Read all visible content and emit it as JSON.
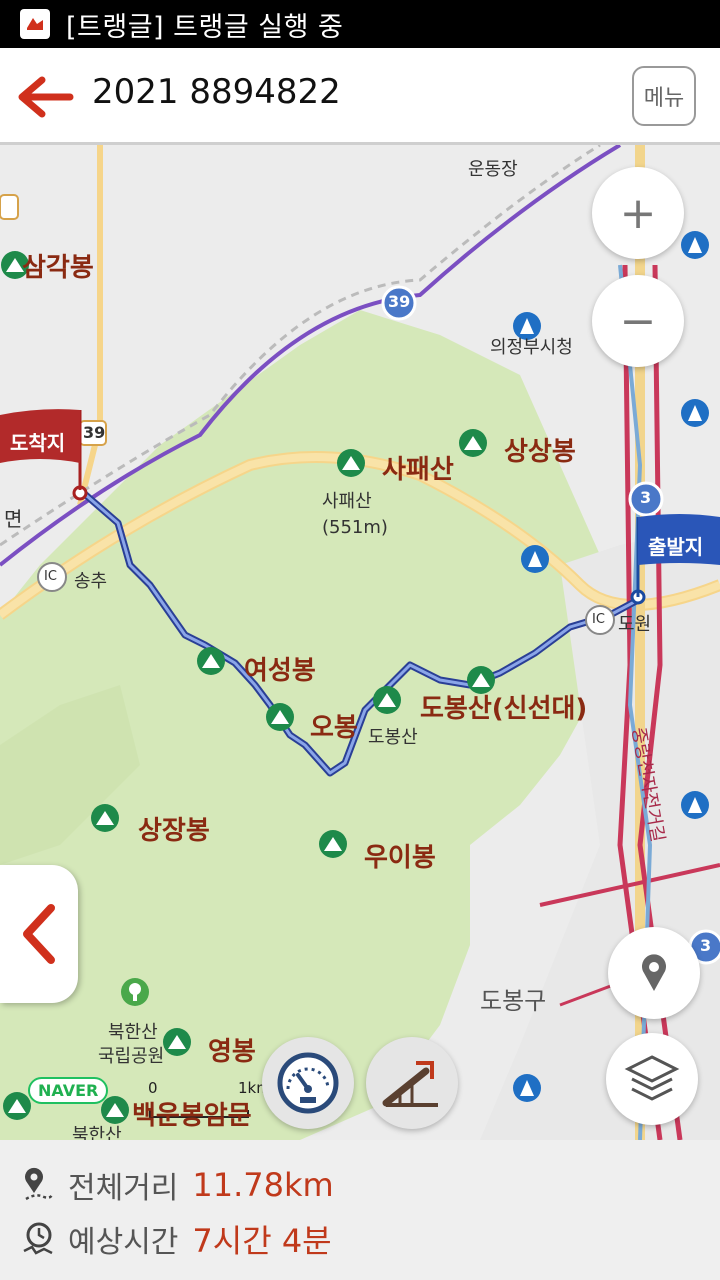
{
  "status_bar": {
    "text": "[트랭글] 트랭글 실행 중"
  },
  "header": {
    "title": "2021 8894822",
    "menu_label": "메뉴"
  },
  "map": {
    "labels": {
      "samgakbong": "삼각봉",
      "sapaesan": "사패산",
      "sapaesan_peak": "사패산",
      "sapaesan_height": "(551m)",
      "sangsangbong": "상상봉",
      "yeoseongbong": "여성봉",
      "obong": "오봉",
      "dobongsan_main": "도봉산(신선대)",
      "dobongsan": "도봉산",
      "sangjangbong": "상장봉",
      "uibong": "우이봉",
      "dobonggu": "도봉구",
      "bukhansan_park_1": "북한산",
      "bukhansan_park_2": "국립공원",
      "yeongbong": "영봉",
      "baegundae": "백운봉암문",
      "bukhansan": "북한산",
      "unjangdong": "운동장",
      "uijeongbu": "의정부시청",
      "songchu": "송추",
      "mangwolsa": "도원",
      "myeon": "면",
      "jungnangcheon": "중랑천자전거길",
      "route_39a": "39",
      "route_39b": "39",
      "route_3a": "3",
      "route_3b": "3",
      "ic_label": "IC",
      "ic_label2": "IC"
    },
    "end_flag": "도착지",
    "start_flag": "출발지",
    "naver_logo": "NAVER",
    "scale_zero": "0",
    "scale_km": "1km"
  },
  "controls": {
    "zoom_in": "+",
    "zoom_out": "−"
  },
  "footer": {
    "distance_label": "전체거리",
    "distance_value": "11.78km",
    "time_label": "예상시간",
    "time_value": "7시간 4분"
  },
  "colors": {
    "accent": "#c0391b",
    "route": "#3a52a8",
    "map_green": "#d5e8b9",
    "map_bg": "#ececec"
  }
}
